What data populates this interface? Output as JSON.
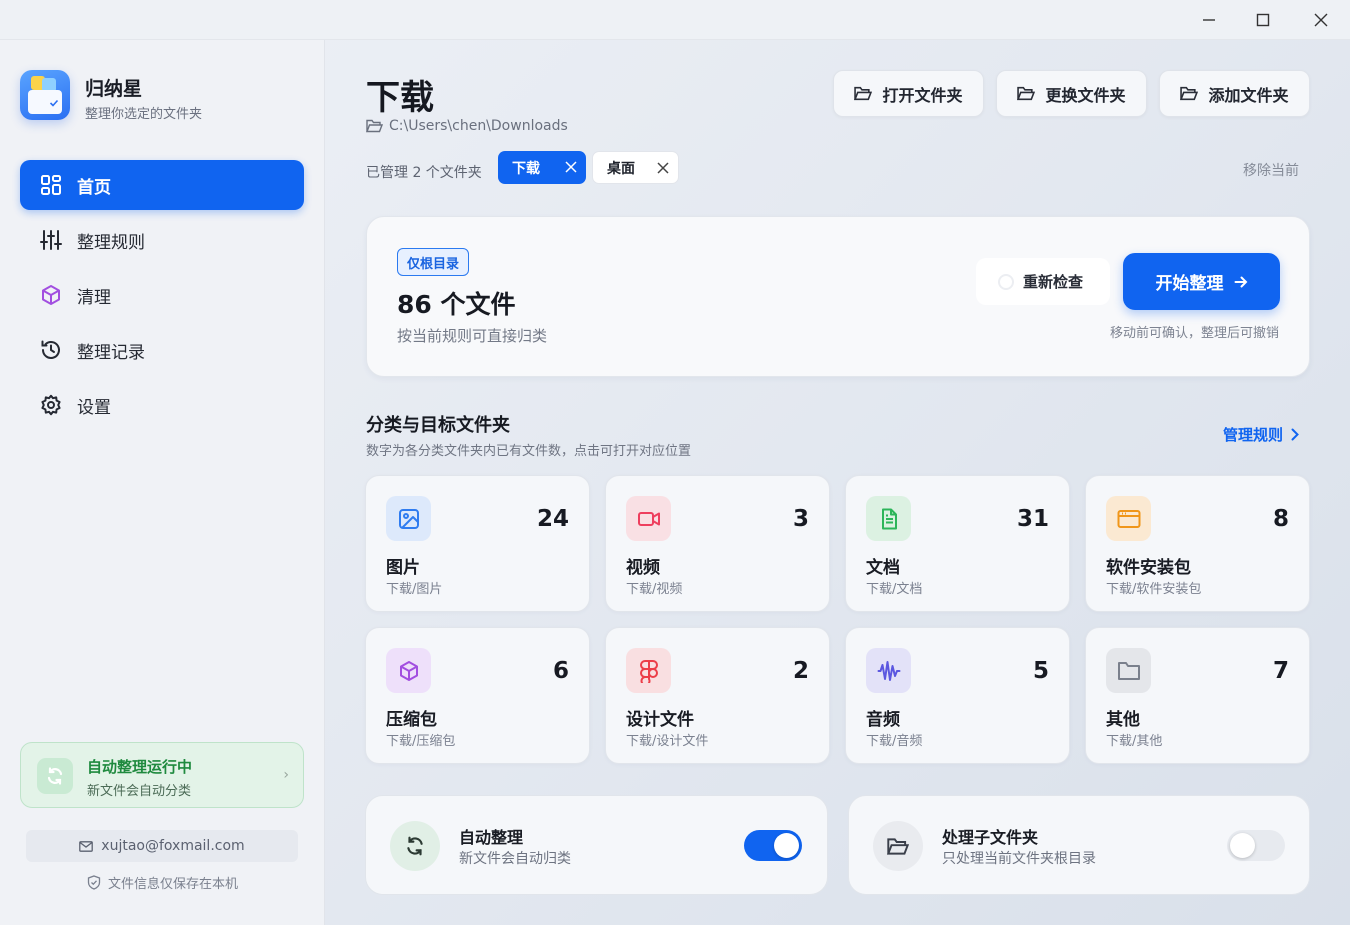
{
  "app": {
    "name": "归纳星",
    "tagline": "整理你选定的文件夹"
  },
  "sidebar": {
    "items": [
      {
        "label": "首页",
        "icon": "dashboard-icon",
        "active": true
      },
      {
        "label": "整理规则",
        "icon": "sliders-icon",
        "active": false
      },
      {
        "label": "清理",
        "icon": "package-icon",
        "active": false
      },
      {
        "label": "整理记录",
        "icon": "history-icon",
        "active": false
      },
      {
        "label": "设置",
        "icon": "gear-icon",
        "active": false
      }
    ],
    "auto_status": {
      "title": "自动整理运行中",
      "subtitle": "新文件会自动分类"
    },
    "email": "xujtao@foxmail.com",
    "privacy": "文件信息仅保存在本机"
  },
  "header": {
    "title": "下载",
    "path": "C:\\Users\\chen\\Downloads",
    "buttons": {
      "open": "打开文件夹",
      "change": "更换文件夹",
      "add": "添加文件夹"
    },
    "managed_label": "已管理 2 个文件夹",
    "folders": [
      "下载",
      "桌面"
    ],
    "remove_current": "移除当前"
  },
  "summary": {
    "badge": "仅根目录",
    "count_text": "86 个文件",
    "description": "按当前规则可直接归类",
    "recheck_label": "重新检查",
    "start_label": "开始整理",
    "hint": "移动前可确认，整理后可撤销"
  },
  "categories_section": {
    "title": "分类与目标文件夹",
    "subtitle": "数字为各分类文件夹内已有文件数，点击可打开对应位置",
    "manage_link": "管理规则",
    "items": [
      {
        "name": "图片",
        "path": "下载/图片",
        "count": "24",
        "icon": "image-icon",
        "color": "#2f7cf0",
        "bg": "#dde9fb"
      },
      {
        "name": "视频",
        "path": "下载/视频",
        "count": "3",
        "icon": "video-icon",
        "color": "#ee3f5e",
        "bg": "#f9e0e4"
      },
      {
        "name": "文档",
        "path": "下载/文档",
        "count": "31",
        "icon": "document-icon",
        "color": "#2db55a",
        "bg": "#dcf1e2"
      },
      {
        "name": "软件安装包",
        "path": "下载/软件安装包",
        "count": "8",
        "icon": "app-window-icon",
        "color": "#f0961a",
        "bg": "#fbe9d2"
      },
      {
        "name": "压缩包",
        "path": "下载/压缩包",
        "count": "6",
        "icon": "package-icon",
        "color": "#a24fe0",
        "bg": "#eee0fa"
      },
      {
        "name": "设计文件",
        "path": "下载/设计文件",
        "count": "2",
        "icon": "figma-icon",
        "color": "#ec3e49",
        "bg": "#f9dfe1"
      },
      {
        "name": "音频",
        "path": "下载/音频",
        "count": "5",
        "icon": "audio-wave-icon",
        "color": "#5b57e0",
        "bg": "#e3e2f8"
      },
      {
        "name": "其他",
        "path": "下载/其他",
        "count": "7",
        "icon": "folder-icon",
        "color": "#7a808c",
        "bg": "#e4e6ea"
      }
    ]
  },
  "toggles": [
    {
      "title": "自动整理",
      "subtitle": "新文件会自动归类",
      "on": true
    },
    {
      "title": "处理子文件夹",
      "subtitle": "只处理当前文件夹根目录",
      "on": false
    }
  ],
  "colors": {
    "accent": "#1064f0",
    "success": "#1f8a3f"
  }
}
